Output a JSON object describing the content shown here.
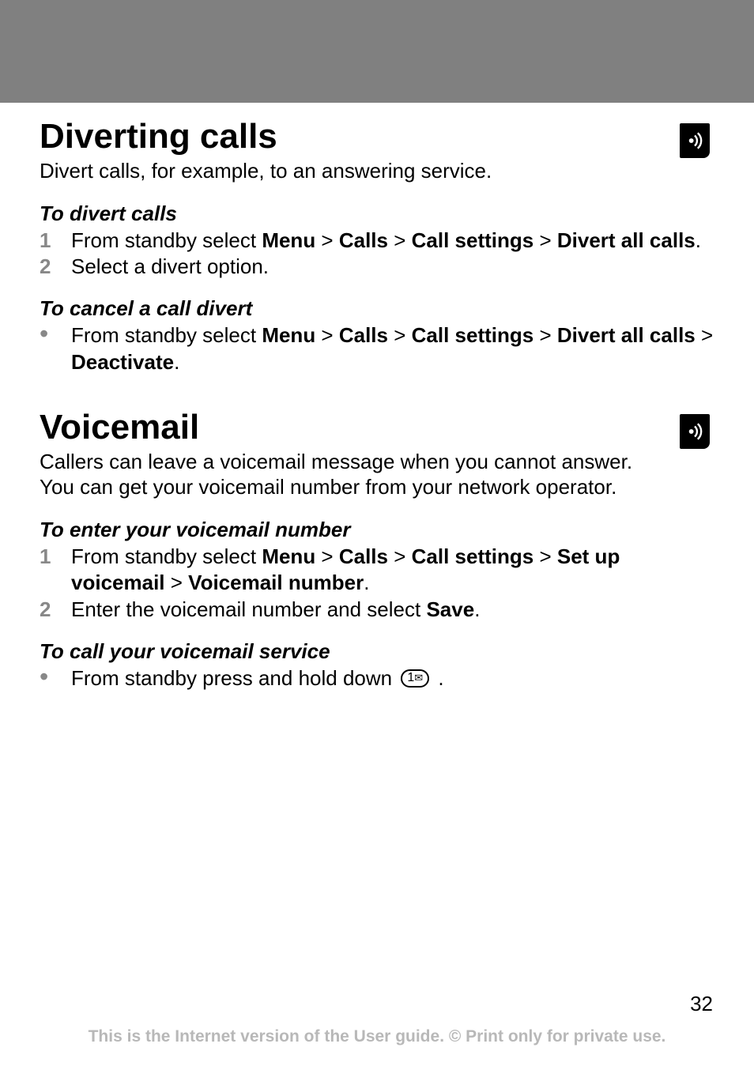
{
  "section1": {
    "title": "Diverting calls",
    "intro": "Divert calls, for example, to an answering service.",
    "sub1": {
      "heading": "To divert calls",
      "items": [
        {
          "marker": "1",
          "pre": "From standby select ",
          "path": [
            "Menu",
            "Calls",
            "Call settings",
            "Divert all calls"
          ],
          "post": "."
        },
        {
          "marker": "2",
          "text": "Select a divert option."
        }
      ]
    },
    "sub2": {
      "heading": "To cancel a call divert",
      "items": [
        {
          "marker": "•",
          "pre": "From standby select ",
          "path": [
            "Menu",
            "Calls",
            "Call settings",
            "Divert all calls",
            "Deactivate"
          ],
          "post": "."
        }
      ]
    }
  },
  "section2": {
    "title": "Voicemail",
    "intro": "Callers can leave a voicemail message when you cannot answer. You can get your voicemail number from your network operator.",
    "sub1": {
      "heading": "To enter your voicemail number",
      "items": [
        {
          "marker": "1",
          "pre": "From standby select ",
          "path": [
            "Menu",
            "Calls",
            "Call settings",
            "Set up voicemail",
            "Voicemail number"
          ],
          "post": "."
        },
        {
          "marker": "2",
          "pre": "Enter the voicemail number and select ",
          "path": [
            "Save"
          ],
          "post": "."
        }
      ]
    },
    "sub2": {
      "heading": "To call your voicemail service",
      "items": [
        {
          "marker": "•",
          "pre": "From standby press and hold down ",
          "key": "1",
          "post": "."
        }
      ]
    }
  },
  "pageNumber": "32",
  "footer": "This is the Internet version of the User guide. © Print only for private use."
}
